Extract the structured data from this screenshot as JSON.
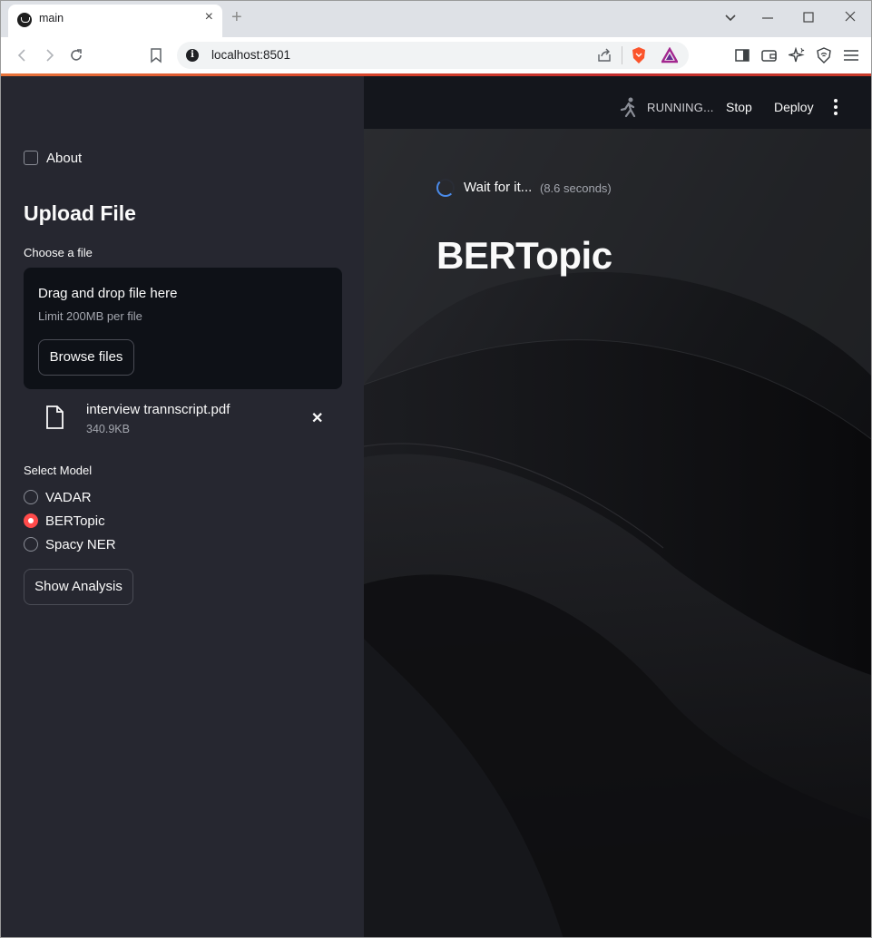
{
  "browser": {
    "tab_title": "main",
    "tab_close": "×",
    "new_tab": "+",
    "url": "localhost:8501",
    "info_glyph": "i"
  },
  "sidebar": {
    "about_label": "About",
    "upload_heading": "Upload File",
    "choose_file_label": "Choose a file",
    "dropzone_title": "Drag and drop file here",
    "dropzone_limit": "Limit 200MB per file",
    "browse_label": "Browse files",
    "file": {
      "name": "interview trannscript.pdf",
      "size": "340.9KB",
      "remove": "✕"
    },
    "select_model_label": "Select Model",
    "models": [
      {
        "label": "VADAR",
        "selected": false
      },
      {
        "label": "BERTopic",
        "selected": true
      },
      {
        "label": "Spacy NER",
        "selected": false
      }
    ],
    "show_analysis_label": "Show Analysis"
  },
  "header": {
    "status": "RUNNING...",
    "stop_label": "Stop",
    "deploy_label": "Deploy"
  },
  "main": {
    "spinner_text": "Wait for it...",
    "spinner_elapsed": "(8.6 seconds)",
    "title": "BERTopic"
  },
  "colors": {
    "sidebar_bg": "#262730",
    "main_bg": "#0e1117",
    "accent": "#ff4b4b",
    "text": "#fafafa"
  }
}
